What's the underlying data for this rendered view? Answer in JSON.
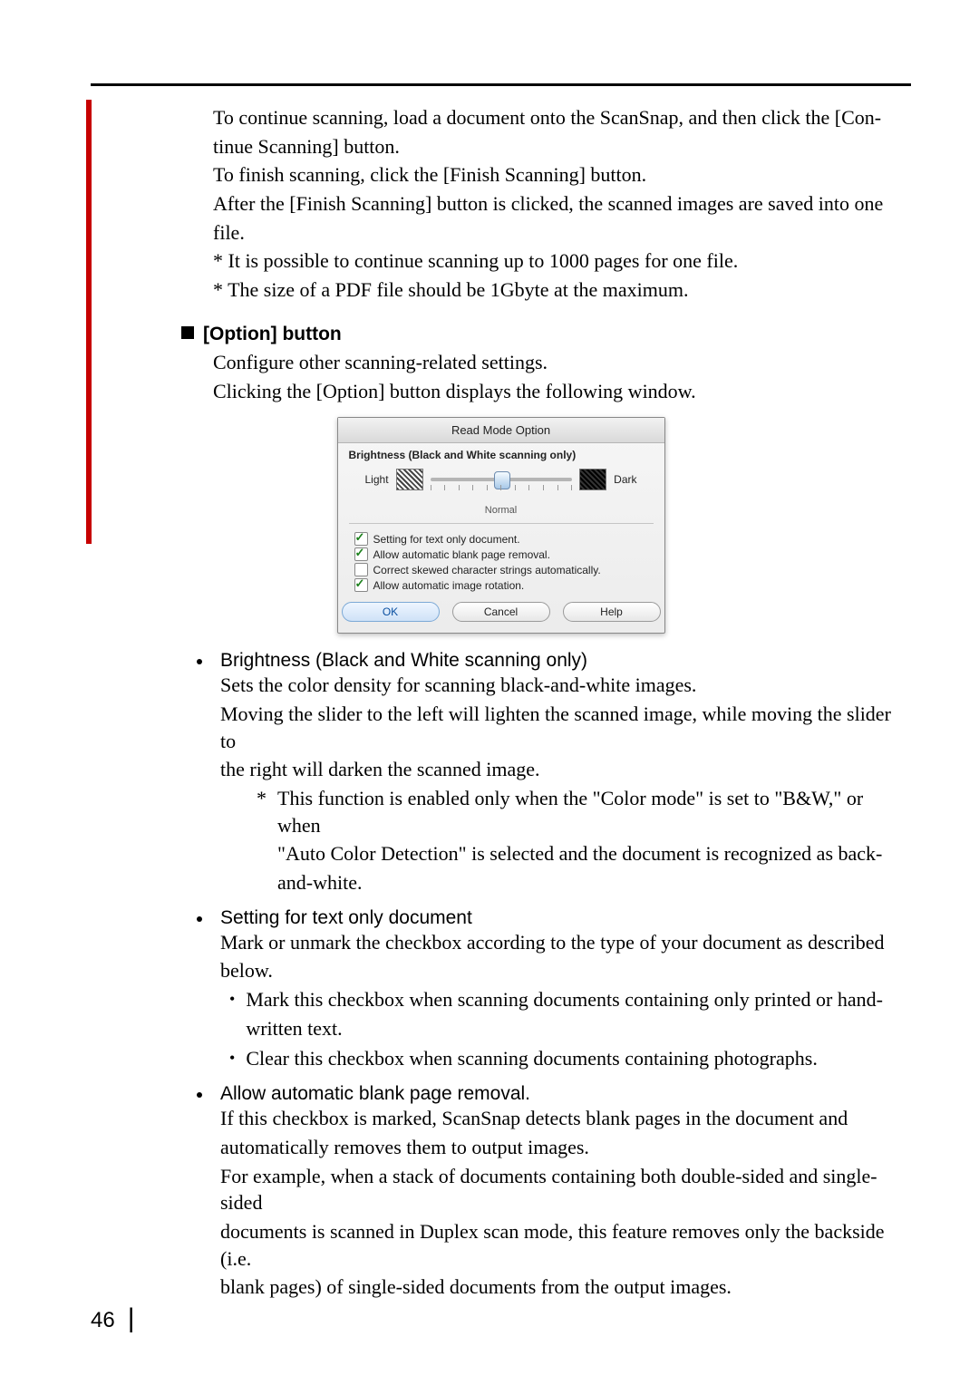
{
  "intro": {
    "p1a": "To continue scanning, load a document onto the ScanSnap, and then click the [Con-",
    "p1b": "tinue Scanning] button.",
    "p2": "To finish scanning, click the [Finish Scanning] button.",
    "p3a": "After the [Finish Scanning] button is clicked, the scanned images are saved into one",
    "p3b": "file.",
    "n1": "* It is possible to continue scanning up to 1000 pages for one file.",
    "n2": "* The size of a PDF file should be 1Gbyte at the maximum."
  },
  "option_heading": "[Option] button",
  "option_desc1": "Configure other scanning-related settings.",
  "option_desc2": "Clicking the [Option] button displays the following window.",
  "dialog": {
    "title": "Read Mode Option",
    "sub": "Brightness (Black and White scanning only)",
    "light": "Light",
    "dark": "Dark",
    "normal": "Normal",
    "opt1": "Setting for text only document.",
    "opt2": "Allow automatic blank page removal.",
    "opt3": "Correct skewed character strings automatically.",
    "opt4": "Allow automatic image rotation.",
    "ok": "OK",
    "cancel": "Cancel",
    "help": "Help"
  },
  "bullets": {
    "b1_head": "Brightness (Black and White scanning only)",
    "b1_l1": "Sets the color density for scanning black-and-white images.",
    "b1_l2": "Moving the slider to the left will lighten the scanned image, while moving the slider to",
    "b1_l3": "the right will darken the scanned image.",
    "b1_s1a": "This function is enabled only when the \"Color mode\" is set to \"B&W,\" or when",
    "b1_s1b": "\"Auto Color Detection\" is selected and the document is recognized as back-",
    "b1_s1c": "and-white.",
    "b2_head": "Setting for text only document",
    "b2_l1": "Mark or unmark the checkbox according to the type of your document as described",
    "b2_l2": "below.",
    "b2_s1a": "Mark this checkbox when scanning documents containing only printed or hand-",
    "b2_s1b": "written text.",
    "b2_s2": "Clear this checkbox when scanning documents containing photographs.",
    "b3_head": "Allow automatic blank page removal.",
    "b3_l1": "If this checkbox is marked, ScanSnap detects blank pages in the document and",
    "b3_l2": "automatically removes them to output images.",
    "b3_l3": "For example, when a stack of documents containing both double-sided and single-sided",
    "b3_l4": "documents is scanned in Duplex scan mode, this feature removes only the backside (i.e.",
    "b3_l5": "blank pages) of single-sided documents from the output images."
  },
  "page_number": "46"
}
